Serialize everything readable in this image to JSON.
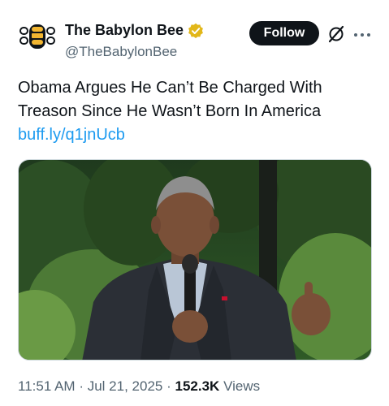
{
  "account": {
    "name": "The Babylon Bee",
    "handle": "@TheBabylonBee",
    "avatar_icon": "babylon-bee-logo-icon",
    "verified_icon": "verified-gold-badge-icon",
    "brand_color": "#f2b631"
  },
  "actions": {
    "follow_label": "Follow",
    "grok_icon": "grok-icon",
    "more_icon": "more-dots-icon"
  },
  "tweet": {
    "text": "Obama Argues He Can’t Be Charged With Treason Since He Wasn’t Born In America",
    "link": "buff.ly/q1jnUcb"
  },
  "media": {
    "description_icon": "photo"
  },
  "meta": {
    "time": "11:51 AM",
    "separator": "·",
    "date": "Jul 21, 2025",
    "views_count": "152.3K",
    "views_label": "Views"
  },
  "colors": {
    "link": "#1d9bf0",
    "secondary_text": "#536471",
    "primary_text": "#0f1419"
  }
}
